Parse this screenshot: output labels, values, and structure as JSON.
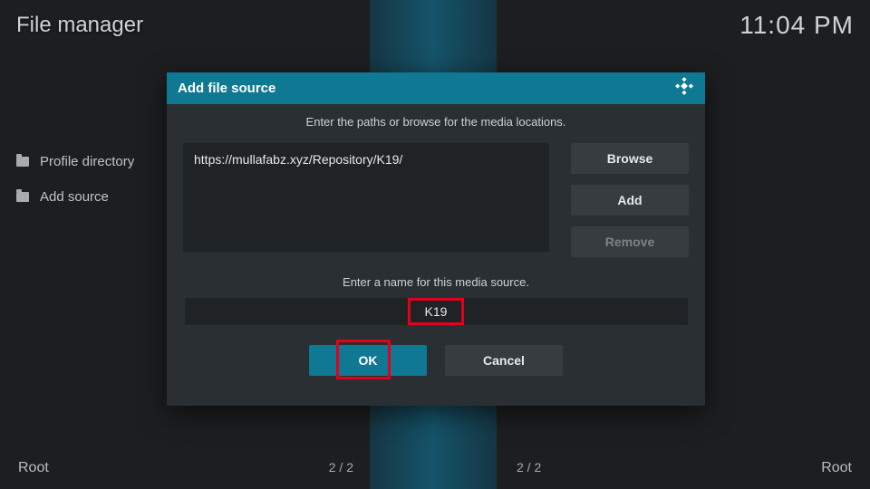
{
  "header": {
    "title": "File manager",
    "clock": "11:04 PM"
  },
  "sidebar": {
    "items": [
      {
        "label": "Profile directory"
      },
      {
        "label": "Add source"
      }
    ]
  },
  "dialog": {
    "title": "Add file source",
    "instruction": "Enter the paths or browse for the media locations.",
    "path": "https://mullafabz.xyz/Repository/K19/",
    "browse_label": "Browse",
    "add_label": "Add",
    "remove_label": "Remove",
    "name_prompt": "Enter a name for this media source.",
    "name_value": "K19",
    "ok_label": "OK",
    "cancel_label": "Cancel"
  },
  "footer": {
    "left_root": "Root",
    "right_root": "Root",
    "left_count": "2 / 2",
    "right_count": "2 / 2"
  }
}
